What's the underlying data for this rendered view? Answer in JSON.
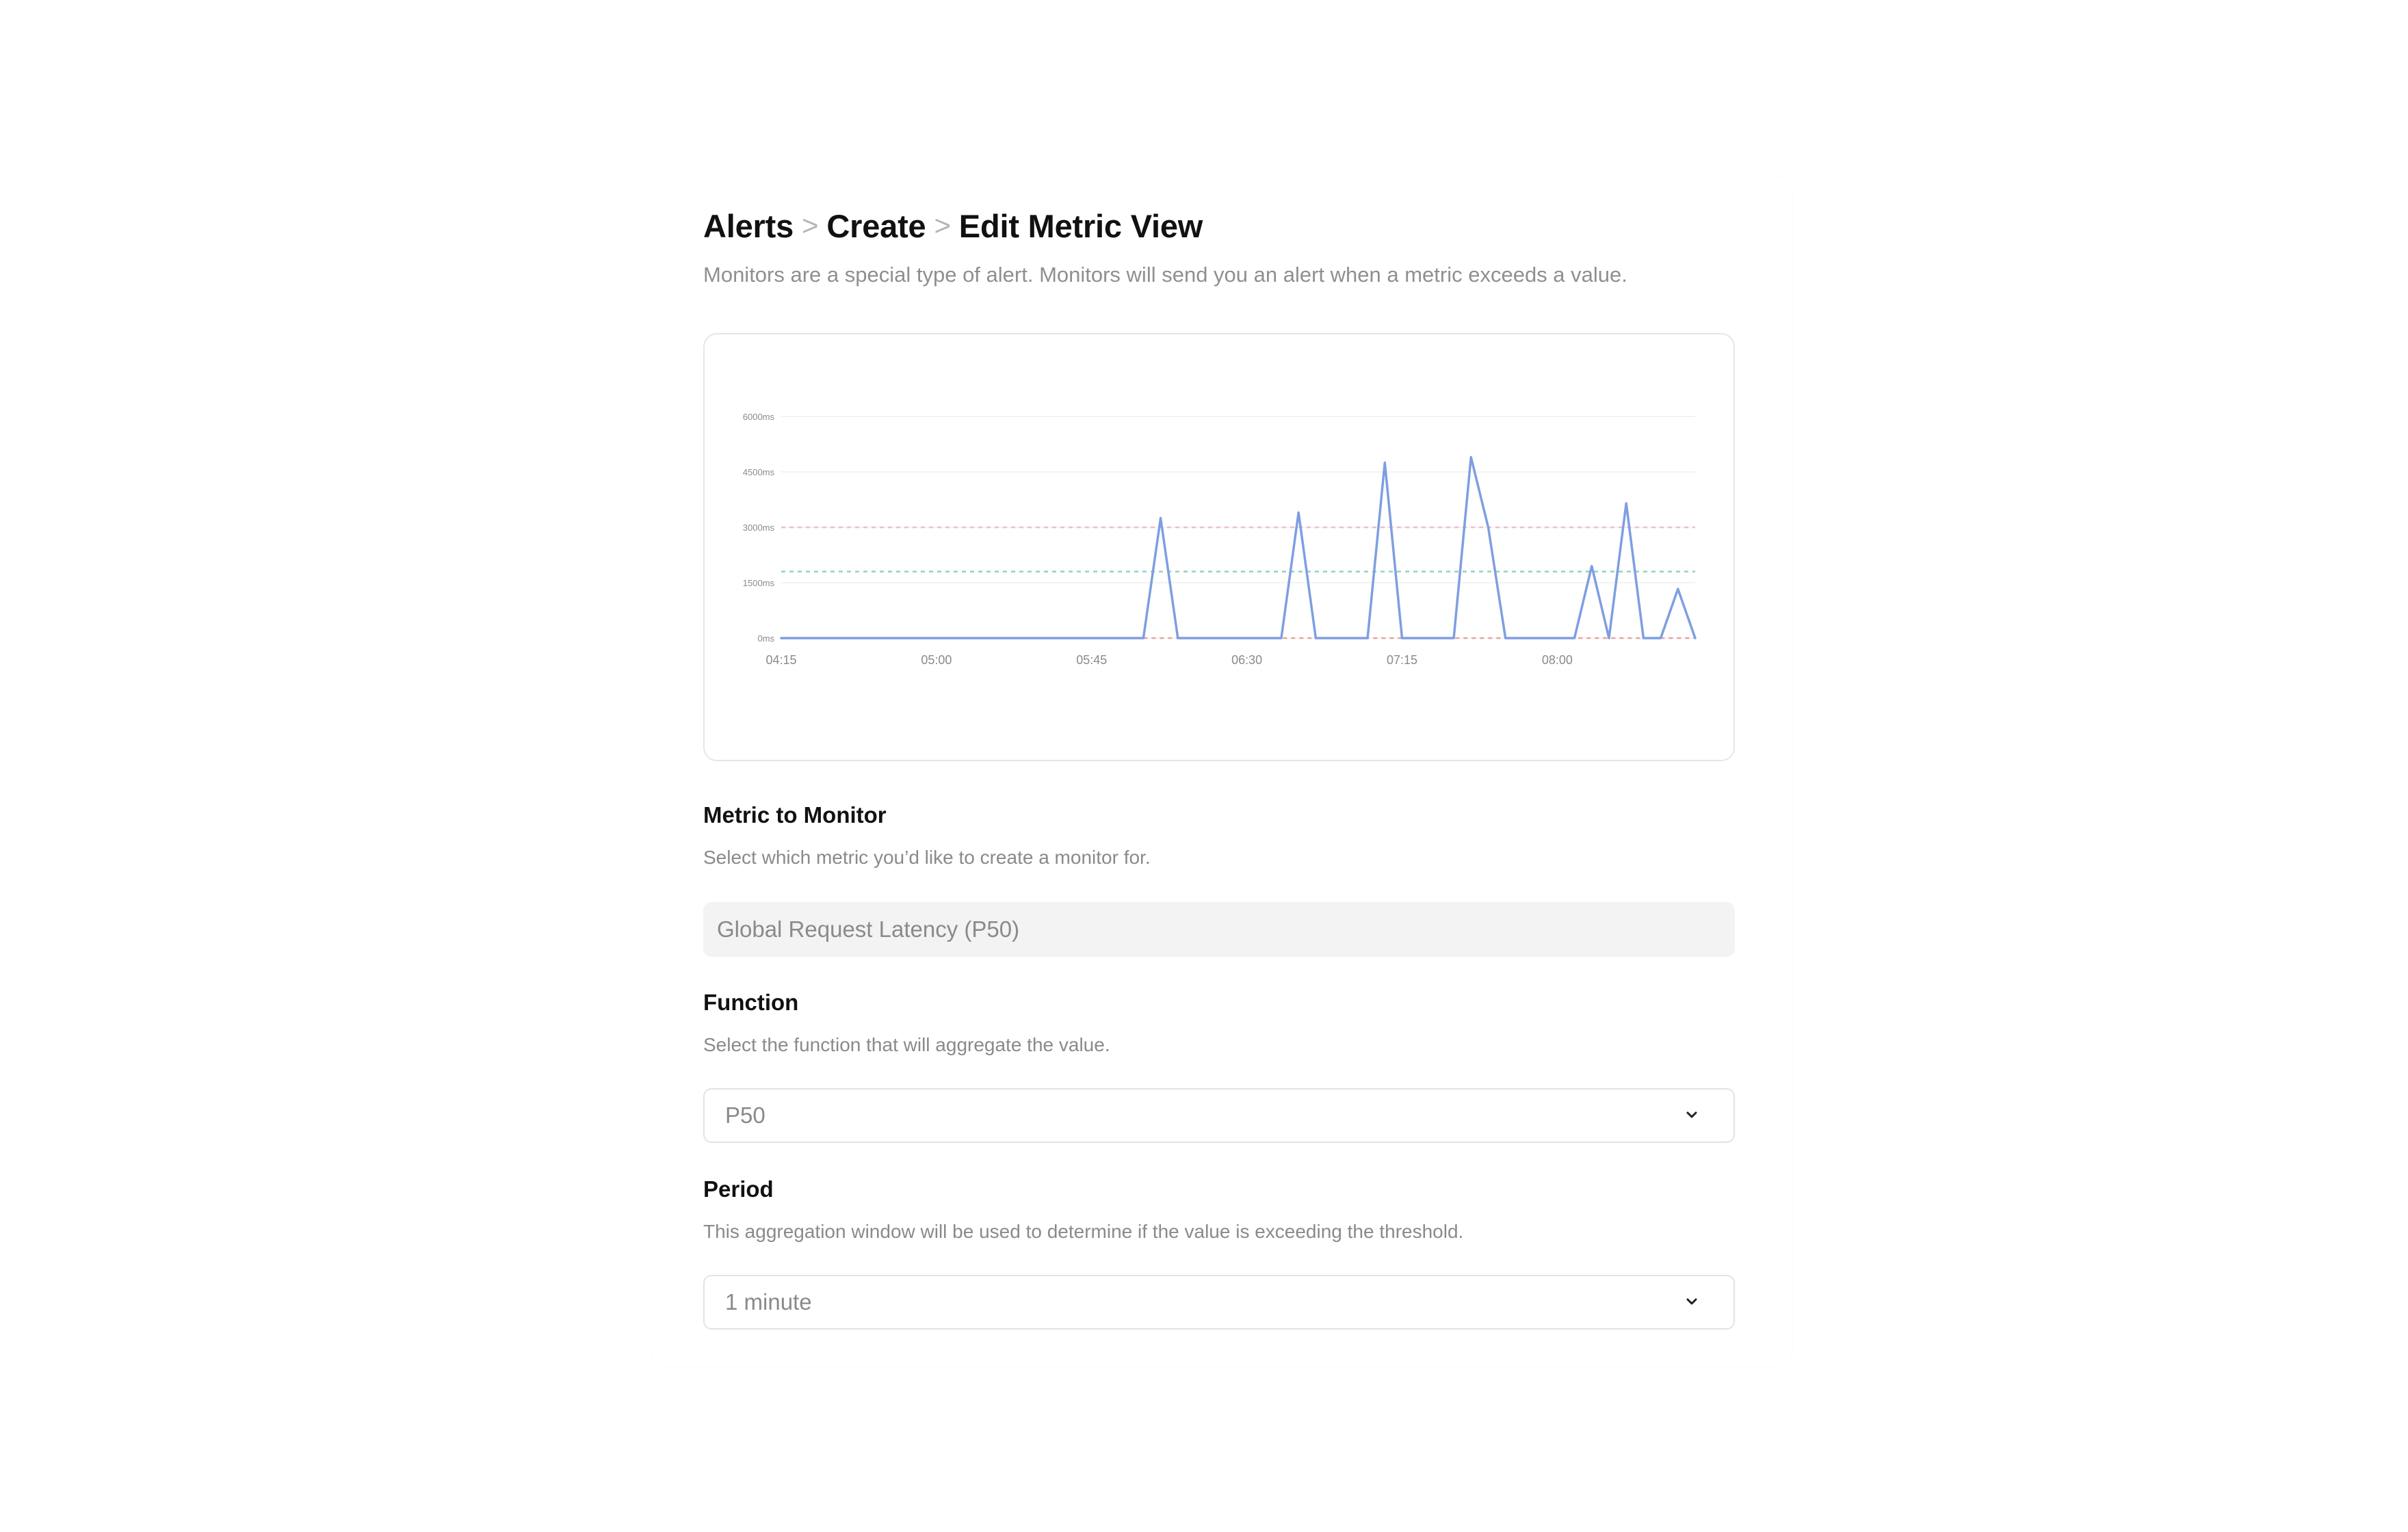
{
  "breadcrumb": {
    "items": [
      "Alerts",
      "Create",
      "Edit Metric View"
    ],
    "separator": ">"
  },
  "subtitle": "Monitors are a special type of alert. Monitors will send you an alert when a metric exceeds a value.",
  "chart_data": {
    "type": "line",
    "title": "",
    "xlabel": "",
    "ylabel": "",
    "ylim": [
      0,
      6000
    ],
    "y_ticks": [
      0,
      1500,
      3000,
      4500,
      6000
    ],
    "y_tick_labels": [
      "0ms",
      "1500ms",
      "3000ms",
      "4500ms",
      "6000ms"
    ],
    "xlim": [
      0,
      265
    ],
    "x_ticks": [
      0,
      45,
      90,
      135,
      180,
      225
    ],
    "x_tick_labels": [
      "04:15",
      "05:00",
      "05:45",
      "06:30",
      "07:15",
      "08:00"
    ],
    "grid": "horizontal",
    "legend": "none",
    "series": [
      {
        "color": "#7f9ee2",
        "x": [
          0,
          105,
          110,
          115,
          145,
          150,
          155,
          170,
          175,
          180,
          195,
          200,
          205,
          210,
          230,
          235,
          240,
          245,
          250,
          255,
          260,
          265
        ],
        "values": [
          0,
          0,
          3250,
          0,
          0,
          3400,
          0,
          0,
          4750,
          0,
          0,
          4900,
          3000,
          0,
          0,
          1950,
          0,
          3650,
          0,
          0,
          1330,
          0
        ]
      }
    ],
    "thresholds": [
      {
        "value": 3000,
        "color": "#f2bccb"
      },
      {
        "value": 1800,
        "color": "#93d3c4"
      },
      {
        "value": 0,
        "color": "#e2a69b"
      }
    ]
  },
  "metric_section": {
    "label": "Metric to Monitor",
    "help": "Select which metric you’d like to create a monitor for.",
    "value": "Global Request Latency (P50)"
  },
  "function_section": {
    "label": "Function",
    "help": "Select the function that will aggregate the value.",
    "value": "P50",
    "icon": "chevron-down-icon"
  },
  "period_section": {
    "label": "Period",
    "help": "This aggregation window will be used to determine if the value is exceeding the threshold.",
    "value": "1 minute",
    "icon": "chevron-down-icon"
  }
}
